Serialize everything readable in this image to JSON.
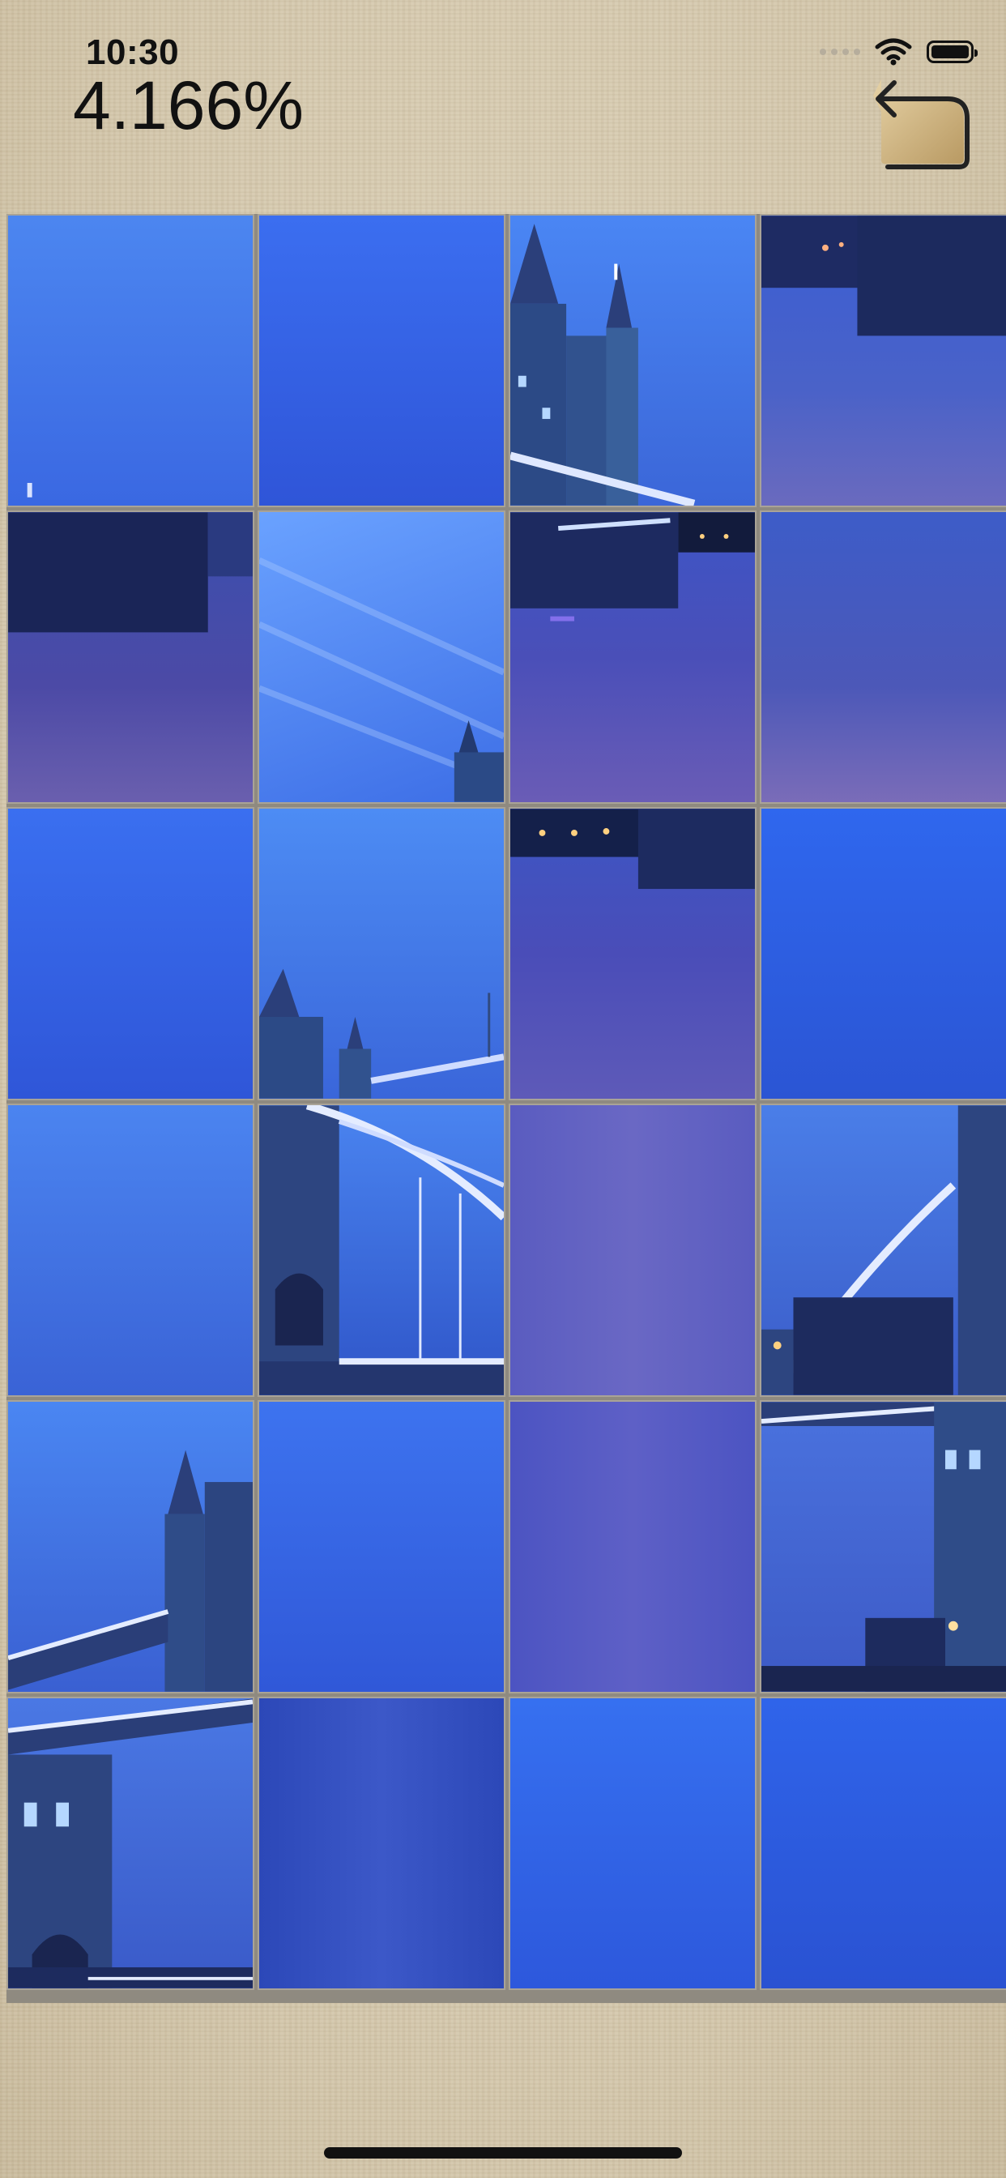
{
  "status_bar": {
    "time": "10:30"
  },
  "game": {
    "progress_text": "4.166%",
    "undo_icon": "undo-arrow-icon",
    "grid": {
      "rows": 6,
      "cols": 4
    }
  },
  "colors": {
    "background": "#d9cdb3",
    "tile_border": "#a9a397",
    "sky": "#3f6fe6",
    "water": "#4a4fb8"
  }
}
